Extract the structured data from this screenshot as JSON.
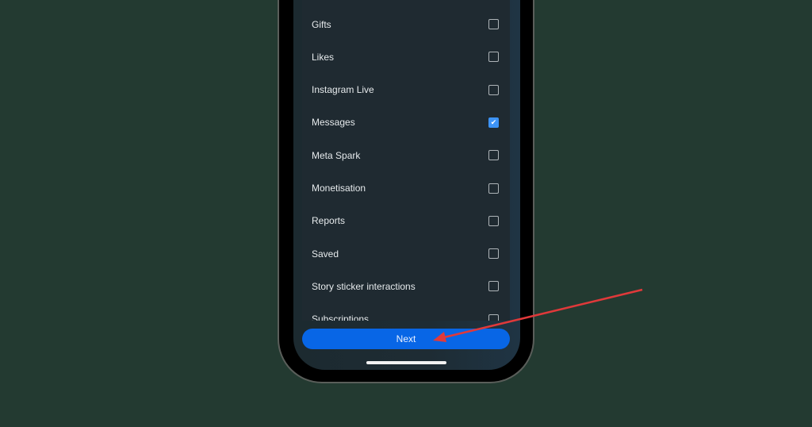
{
  "items": [
    {
      "label": "Gifts",
      "checked": false
    },
    {
      "label": "Likes",
      "checked": false
    },
    {
      "label": "Instagram Live",
      "checked": false
    },
    {
      "label": "Messages",
      "checked": true
    },
    {
      "label": "Meta Spark",
      "checked": false
    },
    {
      "label": "Monetisation",
      "checked": false
    },
    {
      "label": "Reports",
      "checked": false
    },
    {
      "label": "Saved",
      "checked": false
    },
    {
      "label": "Story sticker interactions",
      "checked": false
    },
    {
      "label": "Subscriptions",
      "checked": false
    }
  ],
  "next_label": "Next",
  "colors": {
    "accent": "#0866e6",
    "annotation_arrow": "#e0393a",
    "background": "#233a31"
  }
}
